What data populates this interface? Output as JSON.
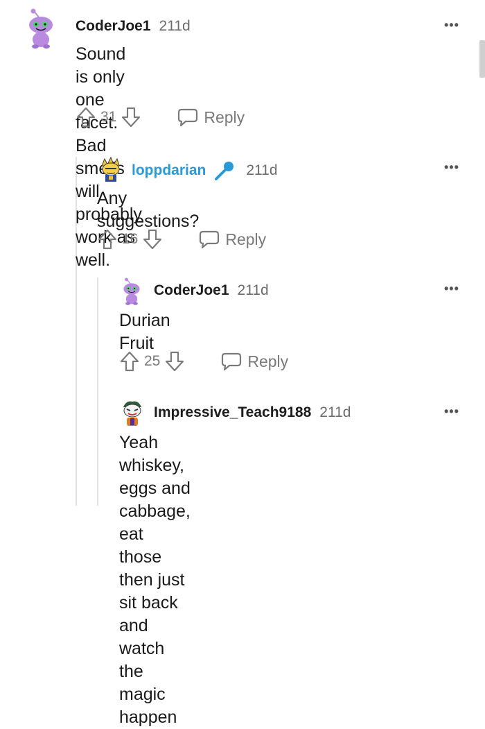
{
  "comments": [
    {
      "username": "CoderJoe1",
      "age": "211d",
      "text_lines": [
        "Sound is only one facet. Bad smells will",
        "probably work as well."
      ],
      "upvotes": "31",
      "reply_label": "Reply"
    },
    {
      "username": "loppdarian",
      "age": "211d",
      "text_lines": [
        "Any suggestions?"
      ],
      "upvotes": "16",
      "reply_label": "Reply"
    },
    {
      "username": "CoderJoe1",
      "age": "211d",
      "text_lines": [
        "Durian Fruit"
      ],
      "upvotes": "25",
      "reply_label": "Reply"
    },
    {
      "username": "Impressive_Teach9188",
      "age": "211d",
      "text_lines": [
        "Yeah whiskey, eggs and cabbage, eat",
        "those then just sit back and watch the",
        "magic happen"
      ]
    }
  ],
  "colors": {
    "op_username": "#2a9ad6",
    "snoo_purple": "#b88be0",
    "meta_gray": "#7a7a7a"
  },
  "icons": [
    "more-options-icon",
    "upvote-icon",
    "downvote-icon",
    "reply-bubble-icon",
    "microphone-icon"
  ]
}
